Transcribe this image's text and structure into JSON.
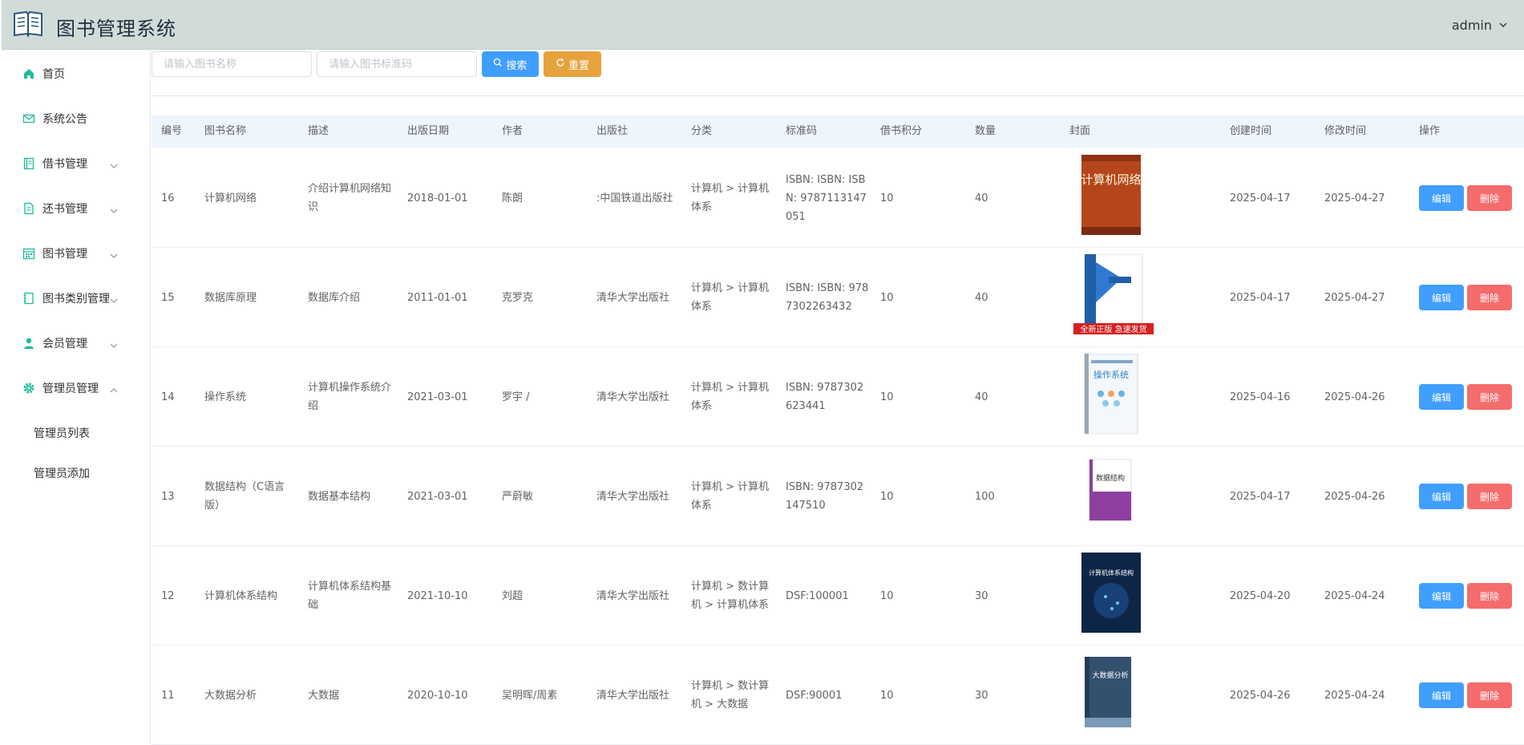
{
  "app": {
    "title": "图书管理系统",
    "user": "admin"
  },
  "sidebar": {
    "items": [
      {
        "label": "首页"
      },
      {
        "label": "系统公告"
      },
      {
        "label": "借书管理"
      },
      {
        "label": "还书管理"
      },
      {
        "label": "图书管理"
      },
      {
        "label": "图书类别管理"
      },
      {
        "label": "会员管理"
      },
      {
        "label": "管理员管理"
      }
    ],
    "subitems": [
      {
        "label": "管理员列表"
      },
      {
        "label": "管理员添加"
      }
    ],
    "accent_color": "#1abc9c"
  },
  "toolbar": {
    "name_placeholder": "请输入图书名称",
    "isbn_placeholder": "请输入图书标准码",
    "search_label": "搜索",
    "reset_label": "重置"
  },
  "table": {
    "headers": [
      "编号",
      "图书名称",
      "描述",
      "出版日期",
      "作者",
      "出版社",
      "分类",
      "标准码",
      "借书积分",
      "数量",
      "封面",
      "创建时间",
      "修改时间",
      "操作"
    ],
    "edit_label": "编辑",
    "delete_label": "删除",
    "rows": [
      {
        "id": "16",
        "name": "计算机网络",
        "desc": "介绍计算机网络知识",
        "pubdate": "2018-01-01",
        "author": "陈朗",
        "publisher": ":中国铁道出版社",
        "category": "计算机 > 计算机体系",
        "isbn": "ISBN: ISBN: ISBN: 9787113147051",
        "points": "10",
        "qty": "40",
        "cover_title": "计算机网络",
        "cover_banner": "",
        "created": "2025-04-17",
        "modified": "2025-04-27"
      },
      {
        "id": "15",
        "name": "数据库原理",
        "desc": "数据库介绍",
        "pubdate": "2011-01-01",
        "author": "克罗克",
        "publisher": "清华大学出版社",
        "category": "计算机 > 计算机体系",
        "isbn": "ISBN: ISBN: 9787302263432",
        "points": "10",
        "qty": "40",
        "cover_title": "",
        "cover_banner": "全新正版 急速发货",
        "created": "2025-04-17",
        "modified": "2025-04-27"
      },
      {
        "id": "14",
        "name": "操作系统",
        "desc": "计算机操作系统介绍",
        "pubdate": "2021-03-01",
        "author": "罗宇 /",
        "publisher": "清华大学出版社",
        "category": "计算机 > 计算机体系",
        "isbn": "ISBN: 9787302623441",
        "points": "10",
        "qty": "40",
        "cover_title": "操作系统",
        "cover_banner": "",
        "created": "2025-04-16",
        "modified": "2025-04-26"
      },
      {
        "id": "13",
        "name": "数据结构（C语言版）",
        "desc": "数据基本结构",
        "pubdate": "2021-03-01",
        "author": "严蔚敏",
        "publisher": "清华大学出版社",
        "category": "计算机 > 计算机体系",
        "isbn": "ISBN: 9787302147510",
        "points": "10",
        "qty": "100",
        "cover_title": "数据结构",
        "cover_banner": "",
        "created": "2025-04-17",
        "modified": "2025-04-26"
      },
      {
        "id": "12",
        "name": "计算机体系结构",
        "desc": "计算机体系结构基础",
        "pubdate": "2021-10-10",
        "author": "刘超",
        "publisher": "清华大学出版社",
        "category": "计算机 > 数计算机 > 计算机体系",
        "isbn": "DSF:100001",
        "points": "10",
        "qty": "30",
        "cover_title": "计算机体系结构",
        "cover_banner": "",
        "created": "2025-04-20",
        "modified": "2025-04-24"
      },
      {
        "id": "11",
        "name": "大数据分析",
        "desc": "大数据",
        "pubdate": "2020-10-10",
        "author": "吴明晖/周素",
        "publisher": "清华大学出版社",
        "category": "计算机 > 数计算机 > 大数据",
        "isbn": "DSF:90001",
        "points": "10",
        "qty": "30",
        "cover_title": "大数据分析",
        "cover_banner": "",
        "created": "2025-04-26",
        "modified": "2025-04-24"
      }
    ]
  }
}
